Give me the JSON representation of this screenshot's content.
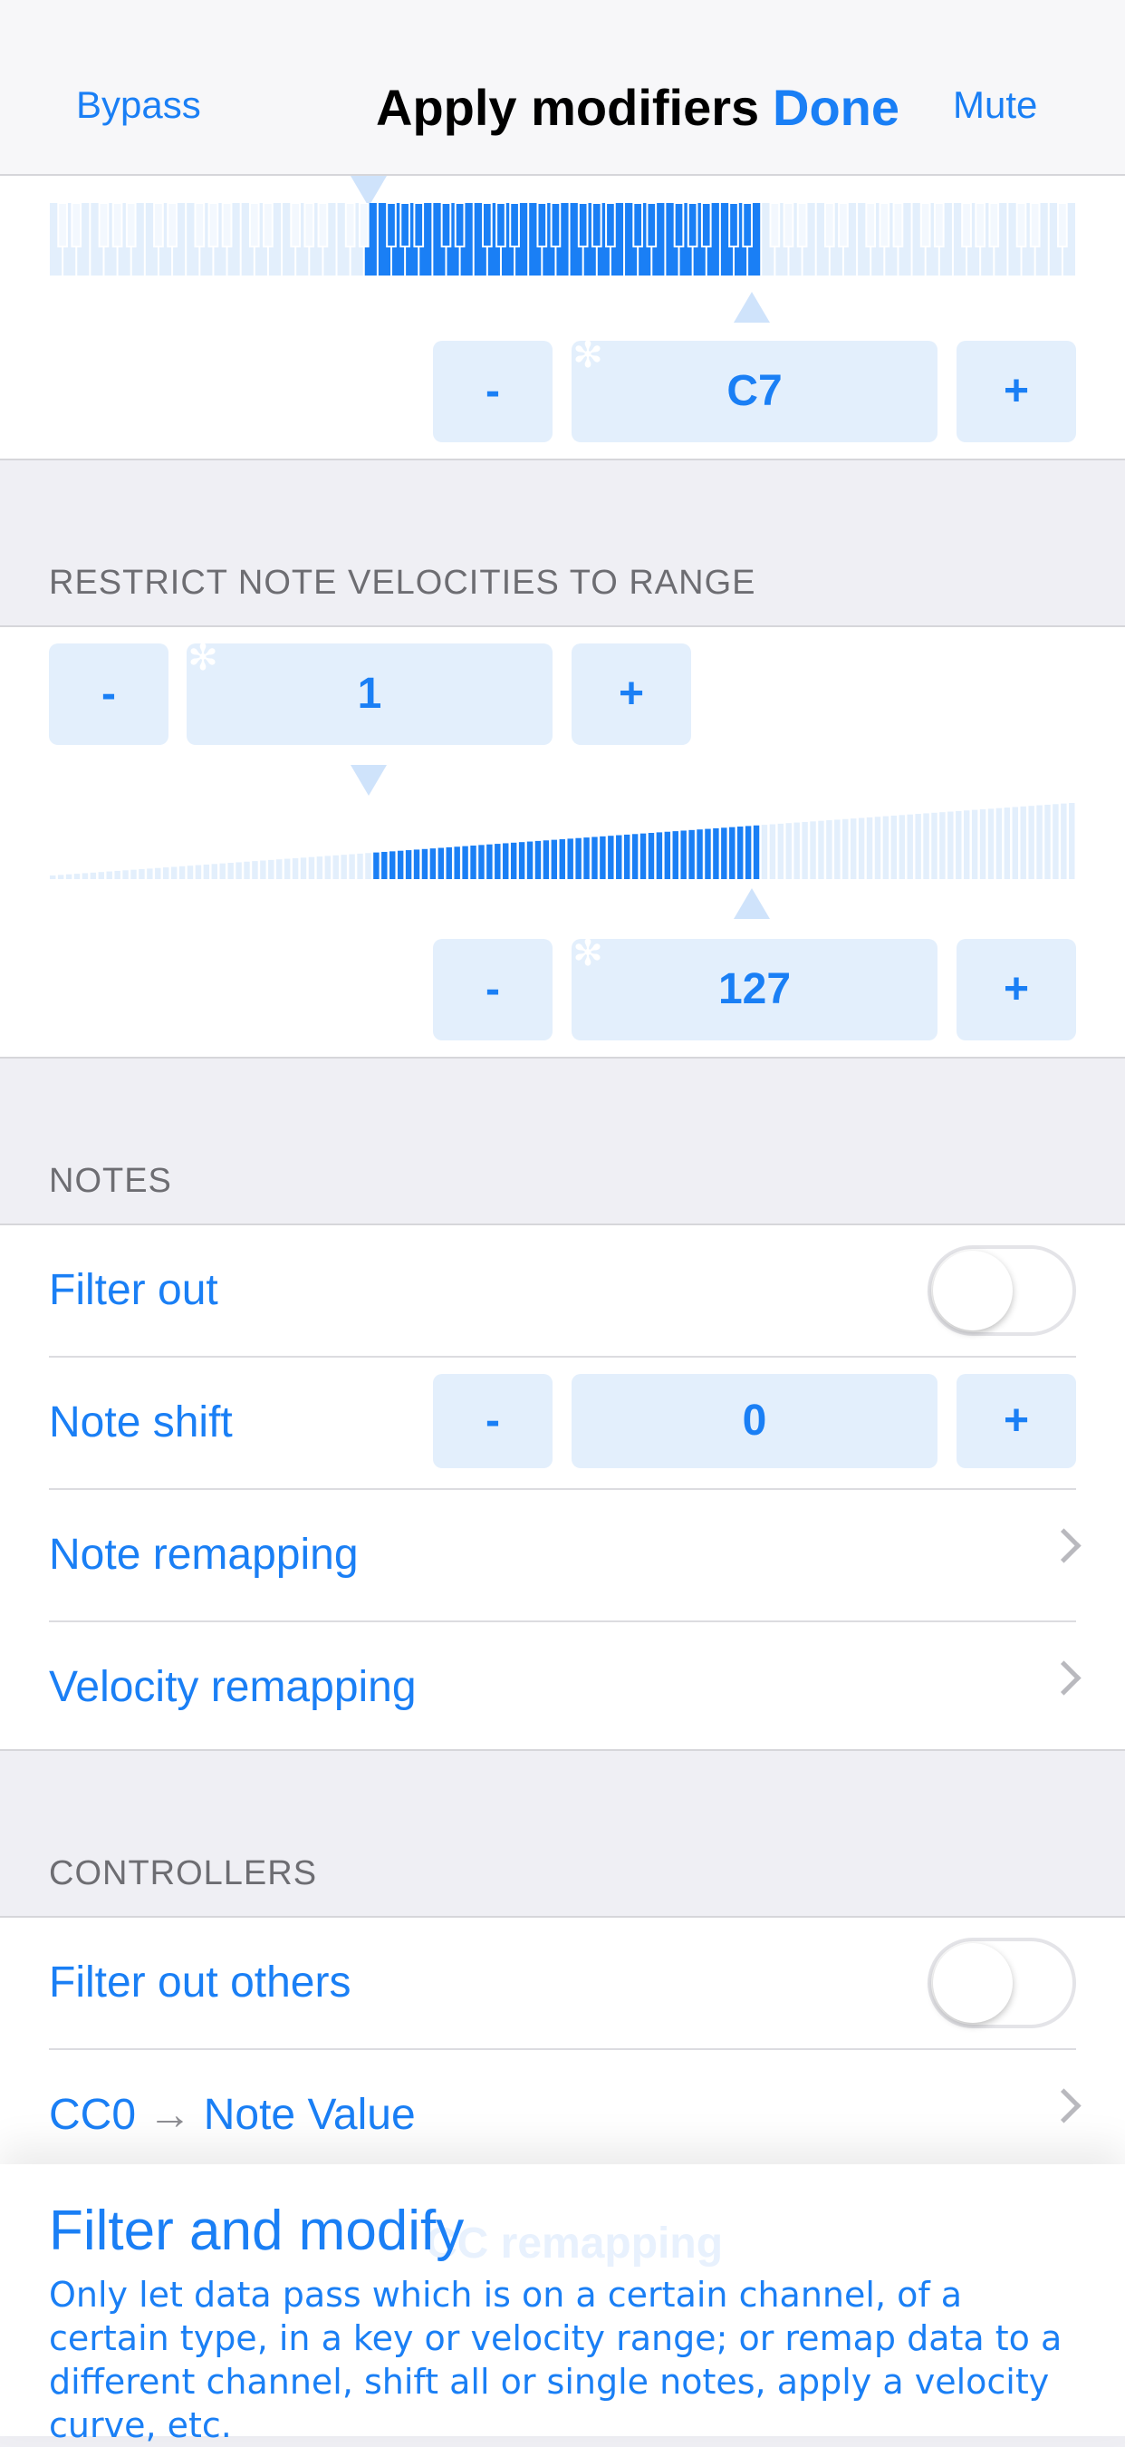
{
  "nav": {
    "left": "Bypass",
    "title": "Apply modifiers",
    "done": "Done",
    "right": "Mute"
  },
  "keyboard_range": {
    "upper": {
      "minus": "-",
      "value": "C7",
      "plus": "+"
    }
  },
  "velocity_section": {
    "header": "RESTRICT NOTE VELOCITIES TO RANGE",
    "lower": {
      "minus": "-",
      "value": "1",
      "plus": "+"
    },
    "upper": {
      "minus": "-",
      "value": "127",
      "plus": "+"
    },
    "selected_range": [
      1,
      127
    ]
  },
  "notes_section": {
    "header": "NOTES",
    "filter_out": {
      "label": "Filter out",
      "on": false
    },
    "note_shift": {
      "label": "Note shift",
      "minus": "-",
      "value": "0",
      "plus": "+"
    },
    "note_remapping": "Note remapping",
    "velocity_remapping": "Velocity remapping"
  },
  "controllers_section": {
    "header": "CONTROLLERS",
    "filter_out_others": {
      "label": "Filter out others",
      "on": false
    },
    "cc_mapping": {
      "source": "CC0",
      "arrow": "→",
      "target": "Note Value"
    }
  },
  "bottom_panel": {
    "ghost": "CC remapping",
    "title": "Filter and modify",
    "text": "Only let data pass which is on a certain channel, of a certain type, in a key or velocity range; or remap data to a different channel, shift all or single notes, apply a velocity curve, etc."
  },
  "colors": {
    "accent": "#1a7ff5",
    "accent_light": "#e3effc",
    "background": "#efeff4"
  }
}
